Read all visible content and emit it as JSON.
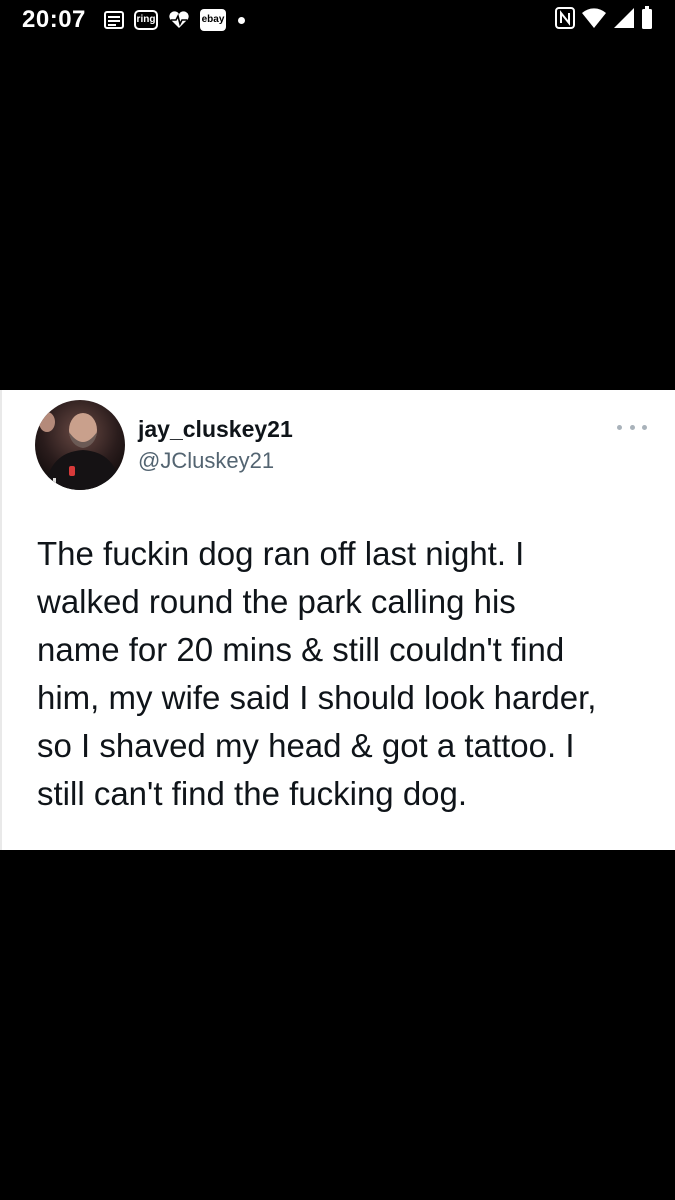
{
  "status_bar": {
    "time": "20:07",
    "notification_icons": [
      "news-icon",
      "ring-icon",
      "health-icon",
      "ebay-icon",
      "dot-icon"
    ],
    "ring_label": "ring",
    "ebay_label": "ebay",
    "system_icons": [
      "nfc-icon",
      "wifi-icon",
      "signal-icon",
      "battery-icon"
    ]
  },
  "tweet": {
    "display_name": "jay_cluskey21",
    "handle": "@JCluskey21",
    "text": "The fuckin dog ran off last night. I\nwalked round the park calling his\nname for 20 mins & still couldn't find\nhim, my wife said I should look harder,\nso I shaved my head & got a tattoo. I\nstill can't find the fucking dog."
  },
  "colors": {
    "background": "#000000",
    "card": "#ffffff",
    "name": "#0f1419",
    "handle": "#536471",
    "more_dots": "#a9b2ba"
  }
}
